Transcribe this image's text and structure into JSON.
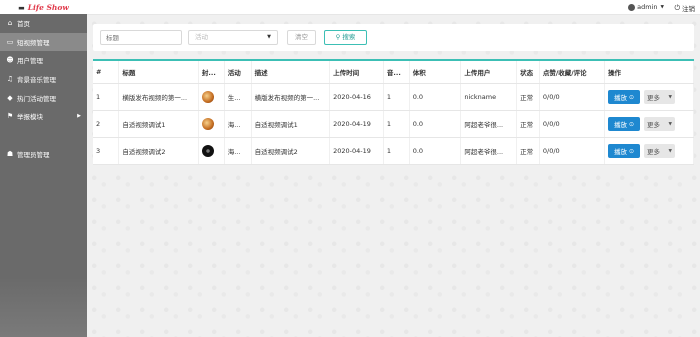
{
  "brand": {
    "name": "Life Show",
    "icon": "pot-icon"
  },
  "sidebar": {
    "items": [
      {
        "label": "首页",
        "icon": "home-icon",
        "active": false
      },
      {
        "label": "短视频管理",
        "icon": "video-icon",
        "active": true
      },
      {
        "label": "用户管理",
        "icon": "user-icon",
        "active": false
      },
      {
        "label": "背景音乐管理",
        "icon": "music-icon",
        "active": false
      },
      {
        "label": "热门活动管理",
        "icon": "tag-icon",
        "active": false
      },
      {
        "label": "举报模块",
        "icon": "flag-icon",
        "active": false
      },
      {
        "label": "管理员管理",
        "icon": "admin-icon",
        "active": false
      }
    ]
  },
  "topbar": {
    "username": "admin",
    "logout": "注销"
  },
  "search": {
    "title_placeholder": "标题",
    "activity_placeholder": "活动",
    "clear_label": "清空",
    "search_label": "搜索"
  },
  "table": {
    "columns": [
      "#",
      "标题",
      "封...",
      "活动",
      "描述",
      "上传时间",
      "音...",
      "体积",
      "上传用户",
      "状态",
      "点赞/收藏/评论",
      "操作"
    ],
    "rows": [
      {
        "no": "1",
        "title": "横版发布视频的第一...",
        "activity": "生...",
        "desc": "横版发布视频的第一...",
        "time": "2020-04-16",
        "music": "1",
        "size": "0.0",
        "user": "nickname",
        "status": "正常",
        "stats": "0/0/0"
      },
      {
        "no": "2",
        "title": "自适视频调试1",
        "activity": "海...",
        "desc": "自适视频调试1",
        "time": "2020-04-19",
        "music": "1",
        "size": "0.0",
        "user": "阿超老爷很...",
        "status": "正常",
        "stats": "0/0/0"
      },
      {
        "no": "3",
        "title": "自适视频调试2",
        "activity": "海...",
        "desc": "自适视频调试2",
        "time": "2020-04-19",
        "music": "1",
        "size": "0.0",
        "user": "阿超老爷很...",
        "status": "正常",
        "stats": "0/0/0"
      }
    ],
    "play_label": "播放",
    "more_label": "更多"
  },
  "colors": {
    "accent": "#3cbfb5",
    "primary_button": "#1e88d0",
    "sidebar": "#6a6a6a",
    "brand": "#e0394a"
  }
}
